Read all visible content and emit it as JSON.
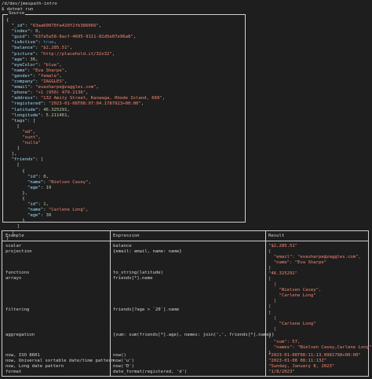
{
  "terminal": {
    "path": "/d/dev/jmespath-intro",
    "command": "$ dotnet run"
  },
  "source": {
    "title": "Source",
    "lines": [
      "{",
      "  \"_id\": \"63aa60070fa420f2fb386066\",",
      "  \"index\": 0,",
      "  \"guid\": \"637a5a58-8acf-4695-9111-82d5e07e96a8\",",
      "  \"isActive\": true,",
      "  \"balance\": \"$2,285.51\",",
      "  \"picture\": \"http://placehold.it/32x32\",",
      "  \"age\": 36,",
      "  \"eyeColor\": \"blue\",",
      "  \"name\": \"Eva Sharpe\",",
      "  \"gender\": \"female\",",
      "  \"company\": \"ZAGGLES\",",
      "  \"email\": \"evasharpe@zaggles.com\",",
      "  \"phone\": \"+1 (950) 479-2136\",",
      "  \"address\": \"132 Amity Street, Kanaaga, Rhode Island, 668\",",
      "  \"registered\": \"2023-01-08T08:07:04.1787923+00:00\",",
      "  \"latitude\": 46.325291,",
      "  \"longitude\": 5.211461,",
      "  \"tags\": [",
      "    [",
      "      \"ad\",",
      "      \"sunt\",",
      "      \"nulla\"",
      "    ]",
      "  ],",
      "  \"friends\": [",
      "    [",
      "      {",
      "        \"id\": 0,",
      "        \"name\": \"Nielsen Casey\",",
      "        \"age\": 19",
      "      },",
      "      {",
      "        \"id\": 1,",
      "        \"name\": \"Carlene Long\",",
      "        \"age\": 38",
      "      }",
      "    ]",
      "  ]",
      "}"
    ]
  },
  "table": {
    "headers": [
      "Example",
      "Expression",
      "Result"
    ],
    "rows": [
      {
        "example": "scalar\nprojection",
        "expression": "balance\n{email: email, name: name}",
        "result": "\"$2,285.51\"\n{\n  \"email\": \"evasharpe@zaggles.com\",\n  \"name\": \"Eva Sharpe\"\n}\n\"46.325291\""
      },
      {
        "example": "functions\narrays",
        "expression": "to_string(latitude)\nfriends[*].name",
        "result": "[\n  [\n    \"Nielsen Casey\",\n    \"Carlene Long\"\n  ]\n]"
      },
      {
        "example": "filtering",
        "expression": "friends[?age > `20`].name",
        "result": "[\n  [\n    \"Carlene Long\"\n  ]\n]"
      },
      {
        "example": "aggregation",
        "expression": "{sum: sum(friends[*].age), names: join(',', friends[*].name)}",
        "result": "{\n  \"sum\": 57,\n  \"names\": \"Nielsen Casey,Carlene Long\"\n}"
      },
      {
        "example": "now, ISO 8601\nnow, Universal sortable date/time pattern\nnow, Long date pattern\nformat",
        "expression": "now()\nnow('u')\nnow('D')\ndate_format(registered, 'd')",
        "result": "\"2023-01-08T08:11:13.0981798+00:00\"\n\"2023-01-08 08:11:13Z\"\n\"Sunday, January 8, 2023\"\n\"1/8/2023\""
      }
    ]
  }
}
